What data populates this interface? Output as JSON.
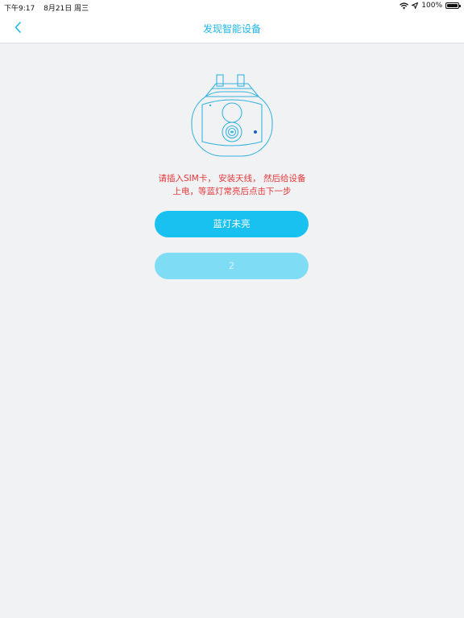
{
  "status_bar": {
    "time": "下午9:17",
    "date": "8月21日 周三",
    "battery_percent": "100%",
    "icons": [
      "wifi-icon",
      "location-arrow-icon",
      "battery-icon"
    ]
  },
  "nav": {
    "title": "发现智能设备",
    "back_icon": "chevron-left-icon"
  },
  "illustration": {
    "icon": "camera-device-icon"
  },
  "instruction": {
    "line1": "请插入SIM卡， 安装天线， 然后给设备",
    "line2": "上电，等蓝灯常亮后点击下一步"
  },
  "buttons": {
    "primary_label": "蓝灯未亮",
    "secondary_label": "2"
  },
  "colors": {
    "accent": "#18c1f0",
    "title": "#1fb6e9",
    "warning_text": "#e5383b",
    "background": "#f1f2f4",
    "disabled_button": "#7fdcf5"
  }
}
